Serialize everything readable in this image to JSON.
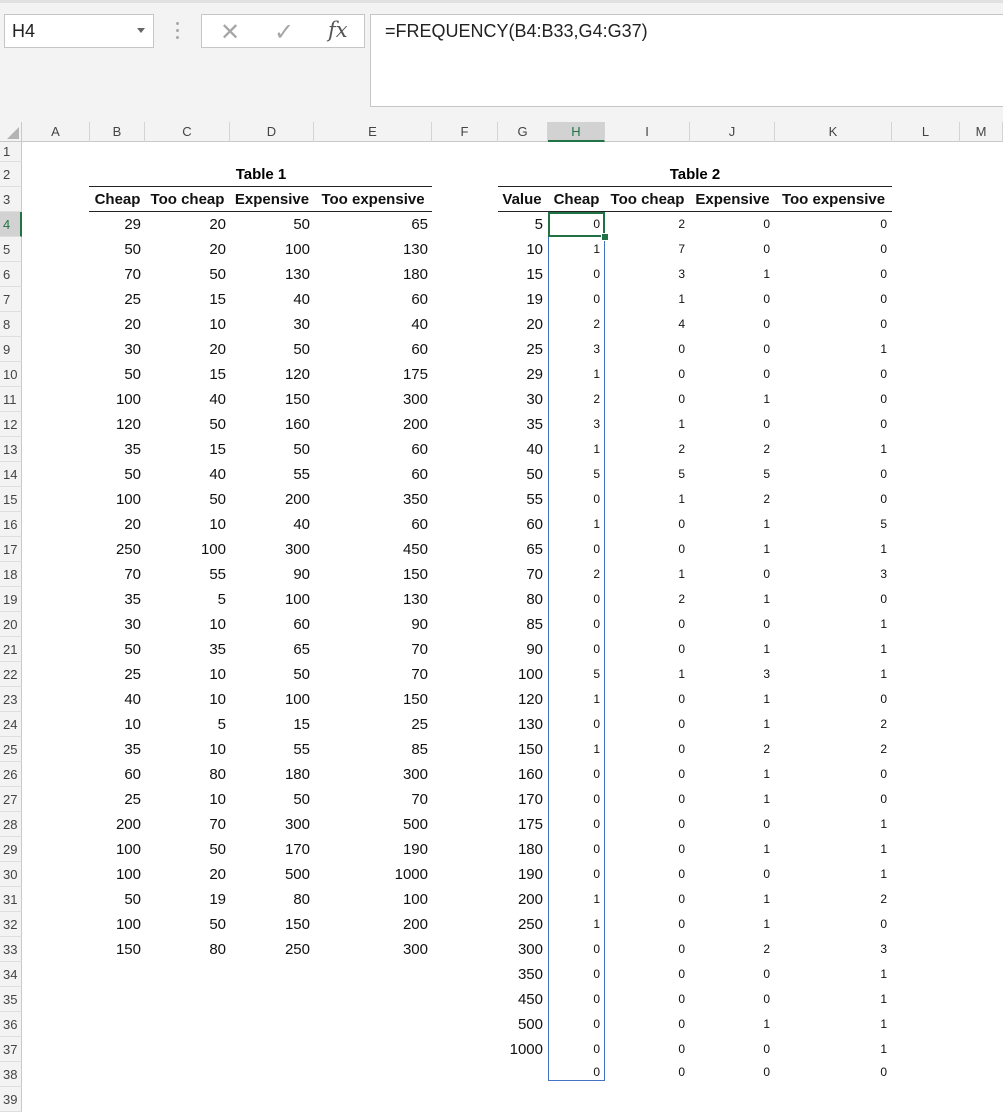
{
  "name_box": "H4",
  "formula_bar": {
    "cancel_glyph": "✕",
    "enter_glyph": "✓",
    "fx_glyph": "fx",
    "formula": "=FREQUENCY(B4:B33,G4:G37)"
  },
  "columns": [
    "A",
    "B",
    "C",
    "D",
    "E",
    "F",
    "G",
    "H",
    "I",
    "J",
    "K",
    "L",
    "M"
  ],
  "rows": [
    "1",
    "2",
    "3",
    "4",
    "5",
    "6",
    "7",
    "8",
    "9",
    "10",
    "11",
    "12",
    "13",
    "14",
    "15",
    "16",
    "17",
    "18",
    "19",
    "20",
    "21",
    "22",
    "23",
    "24",
    "25",
    "26",
    "27",
    "28",
    "29",
    "30",
    "31",
    "32",
    "33",
    "34",
    "35",
    "36",
    "37",
    "38",
    "39"
  ],
  "table1": {
    "title": "Table 1",
    "headers": [
      "Cheap",
      "Too cheap",
      "Expensive",
      "Too expensive"
    ],
    "data": [
      [
        "29",
        "20",
        "50",
        "65"
      ],
      [
        "50",
        "20",
        "100",
        "130"
      ],
      [
        "70",
        "50",
        "130",
        "180"
      ],
      [
        "25",
        "15",
        "40",
        "60"
      ],
      [
        "20",
        "10",
        "30",
        "40"
      ],
      [
        "30",
        "20",
        "50",
        "60"
      ],
      [
        "50",
        "15",
        "120",
        "175"
      ],
      [
        "100",
        "40",
        "150",
        "300"
      ],
      [
        "120",
        "50",
        "160",
        "200"
      ],
      [
        "35",
        "15",
        "50",
        "60"
      ],
      [
        "50",
        "40",
        "55",
        "60"
      ],
      [
        "100",
        "50",
        "200",
        "350"
      ],
      [
        "20",
        "10",
        "40",
        "60"
      ],
      [
        "250",
        "100",
        "300",
        "450"
      ],
      [
        "70",
        "55",
        "90",
        "150"
      ],
      [
        "35",
        "5",
        "100",
        "130"
      ],
      [
        "30",
        "10",
        "60",
        "90"
      ],
      [
        "50",
        "35",
        "65",
        "70"
      ],
      [
        "25",
        "10",
        "50",
        "70"
      ],
      [
        "40",
        "10",
        "100",
        "150"
      ],
      [
        "10",
        "5",
        "15",
        "25"
      ],
      [
        "35",
        "10",
        "55",
        "85"
      ],
      [
        "60",
        "80",
        "180",
        "300"
      ],
      [
        "25",
        "10",
        "50",
        "70"
      ],
      [
        "200",
        "70",
        "300",
        "500"
      ],
      [
        "100",
        "50",
        "170",
        "190"
      ],
      [
        "100",
        "20",
        "500",
        "1000"
      ],
      [
        "50",
        "19",
        "80",
        "100"
      ],
      [
        "100",
        "50",
        "150",
        "200"
      ],
      [
        "150",
        "80",
        "250",
        "300"
      ]
    ]
  },
  "table2": {
    "title": "Table 2",
    "headers": [
      "Value",
      "Cheap",
      "Too cheap",
      "Expensive",
      "Too expensive"
    ],
    "data": [
      [
        "5",
        "0",
        "2",
        "0",
        "0"
      ],
      [
        "10",
        "1",
        "7",
        "0",
        "0"
      ],
      [
        "15",
        "0",
        "3",
        "1",
        "0"
      ],
      [
        "19",
        "0",
        "1",
        "0",
        "0"
      ],
      [
        "20",
        "2",
        "4",
        "0",
        "0"
      ],
      [
        "25",
        "3",
        "0",
        "0",
        "1"
      ],
      [
        "29",
        "1",
        "0",
        "0",
        "0"
      ],
      [
        "30",
        "2",
        "0",
        "1",
        "0"
      ],
      [
        "35",
        "3",
        "1",
        "0",
        "0"
      ],
      [
        "40",
        "1",
        "2",
        "2",
        "1"
      ],
      [
        "50",
        "5",
        "5",
        "5",
        "0"
      ],
      [
        "55",
        "0",
        "1",
        "2",
        "0"
      ],
      [
        "60",
        "1",
        "0",
        "1",
        "5"
      ],
      [
        "65",
        "0",
        "0",
        "1",
        "1"
      ],
      [
        "70",
        "2",
        "1",
        "0",
        "3"
      ],
      [
        "80",
        "0",
        "2",
        "1",
        "0"
      ],
      [
        "85",
        "0",
        "0",
        "0",
        "1"
      ],
      [
        "90",
        "0",
        "0",
        "1",
        "1"
      ],
      [
        "100",
        "5",
        "1",
        "3",
        "1"
      ],
      [
        "120",
        "1",
        "0",
        "1",
        "0"
      ],
      [
        "130",
        "0",
        "0",
        "1",
        "2"
      ],
      [
        "150",
        "1",
        "0",
        "2",
        "2"
      ],
      [
        "160",
        "0",
        "0",
        "1",
        "0"
      ],
      [
        "170",
        "0",
        "0",
        "1",
        "0"
      ],
      [
        "175",
        "0",
        "0",
        "0",
        "1"
      ],
      [
        "180",
        "0",
        "0",
        "1",
        "1"
      ],
      [
        "190",
        "0",
        "0",
        "0",
        "1"
      ],
      [
        "200",
        "1",
        "0",
        "1",
        "2"
      ],
      [
        "250",
        "1",
        "0",
        "1",
        "0"
      ],
      [
        "300",
        "0",
        "0",
        "2",
        "3"
      ],
      [
        "350",
        "0",
        "0",
        "0",
        "1"
      ],
      [
        "450",
        "0",
        "0",
        "0",
        "1"
      ],
      [
        "500",
        "0",
        "0",
        "1",
        "1"
      ],
      [
        "1000",
        "0",
        "0",
        "0",
        "1"
      ],
      [
        "",
        "0",
        "0",
        "0",
        "0"
      ]
    ]
  },
  "colors": {
    "selection": "#217346",
    "array_outline": "#4472c4"
  }
}
